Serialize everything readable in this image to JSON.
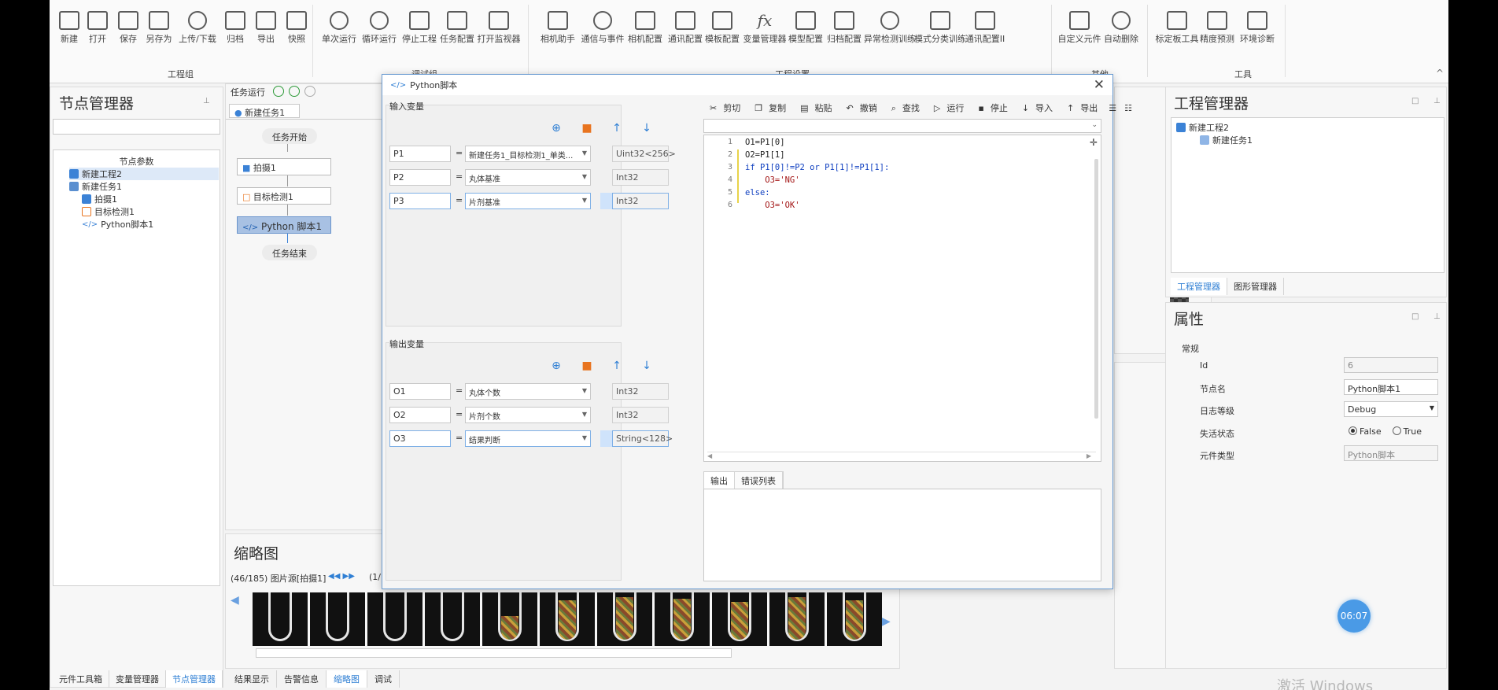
{
  "ribbon": {
    "buttons": [
      "新建",
      "打开",
      "保存",
      "另存为",
      "上传/下载",
      "归档",
      "导出",
      "快照",
      "单次运行",
      "循环运行",
      "停止工程",
      "任务配置",
      "打开监视器",
      "相机助手",
      "通信与事件",
      "相机配置",
      "通讯配置",
      "模板配置",
      "变量管理器",
      "模型配置",
      "归档配置",
      "异常检测训练",
      "模式分类训练",
      "通讯配置II",
      "自定义元件",
      "自动删除",
      "标定板工具",
      "精度预测",
      "环境诊断"
    ],
    "groups": [
      "工程组",
      "调试组",
      "工程设置",
      "其他",
      "工具"
    ]
  },
  "node_manager": {
    "title": "节点管理器",
    "header": "节点参数",
    "tree": [
      "新建工程2",
      "新建任务1",
      "拍摄1",
      "目标检测1",
      "Python脚本1"
    ]
  },
  "task_panel": {
    "run_label": "任务运行",
    "tab": "新建任务1",
    "flow": [
      "任务开始",
      "拍摄1",
      "目标检测1",
      "Python 脚本1",
      "任务结束"
    ]
  },
  "thumbnail_panel": {
    "title": "缩略图",
    "info": "(46/185) 图片源[拍摄1]",
    "page_hint": "(1/"
  },
  "dialog": {
    "title": "Python脚本",
    "input_group": "输入变量",
    "output_group": "输出变量",
    "inputs": [
      {
        "name": "P1",
        "source": "新建任务1_目标检测1_单类...",
        "type": "Uint32<256>"
      },
      {
        "name": "P2",
        "source": "丸体基准",
        "type": "Int32"
      },
      {
        "name": "P3",
        "source": "片剂基准",
        "type": "Int32"
      }
    ],
    "outputs": [
      {
        "name": "O1",
        "source": "丸体个数",
        "type": "Int32"
      },
      {
        "name": "O2",
        "source": "片剂个数",
        "type": "Int32"
      },
      {
        "name": "O3",
        "source": "结果判断",
        "type": "String<128>"
      }
    ],
    "toolbar": [
      "剪切",
      "复制",
      "粘贴",
      "撤销",
      "查找",
      "运行",
      "停止",
      "导入",
      "导出"
    ],
    "code": [
      "O1=P1[0]",
      "O2=P1[1]",
      "if P1[0]!=P2 or P1[1]!=P1[1]:",
      "    O3='NG'",
      "else:",
      "    O3='OK'"
    ],
    "output_tabs": [
      "输出",
      "错误列表"
    ]
  },
  "project_manager": {
    "title": "工程管理器",
    "tree": [
      "新建工程2",
      "新建任务1"
    ],
    "tabs": [
      "工程管理器",
      "图形管理器"
    ]
  },
  "properties": {
    "title": "属性",
    "section": "常规",
    "rows": [
      {
        "label": "Id",
        "value": "6"
      },
      {
        "label": "节点名",
        "value": "Python脚本1"
      },
      {
        "label": "日志等级",
        "value": "Debug"
      },
      {
        "label": "失活状态",
        "value": ""
      },
      {
        "label": "元件类型",
        "value": "Python脚本"
      }
    ],
    "radio_false": "False",
    "radio_true": "True"
  },
  "left_tabs": [
    "元件工具箱",
    "变量管理器",
    "节点管理器"
  ],
  "bottom_tabs": [
    "结果显示",
    "告警信息",
    "缩略图",
    "调试"
  ],
  "timer": "06:07",
  "watermark": "激活 Windows",
  "colors": {
    "accent": "#2f7fd4",
    "node_blue": "#3b82d6",
    "delete_orange": "#e8741f"
  }
}
